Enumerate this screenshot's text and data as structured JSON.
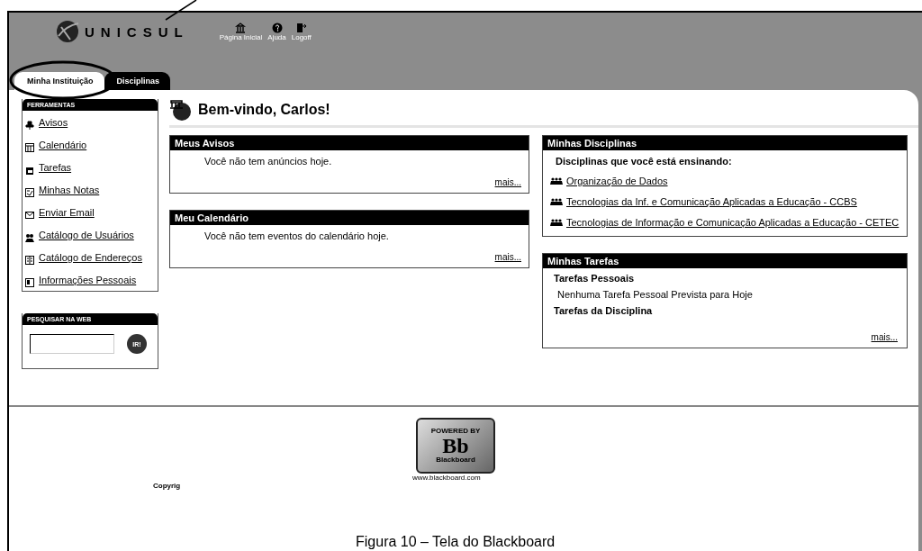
{
  "header": {
    "logo_text": "UNICSUL",
    "nav": [
      {
        "label": "Página Inicial",
        "kind": "home"
      },
      {
        "label": "Ajuda",
        "kind": "help"
      },
      {
        "label": "Logoff",
        "kind": "logoff"
      }
    ]
  },
  "tabs": [
    {
      "label": "Minha Instituição",
      "selected": true
    },
    {
      "label": "Disciplinas",
      "selected": false
    }
  ],
  "sidebar": {
    "title": "FERRAMENTAS",
    "items": [
      {
        "label": "Avisos",
        "kind": "pin"
      },
      {
        "label": "Calendário",
        "kind": "calendar"
      },
      {
        "label": "Tarefas",
        "kind": "tasks"
      },
      {
        "label": "Minhas Notas",
        "kind": "notes"
      },
      {
        "label": "Enviar Email",
        "kind": "mail"
      },
      {
        "label": "Catálogo de Usuários",
        "kind": "users"
      },
      {
        "label": "Catálogo de Endereços",
        "kind": "book"
      },
      {
        "label": "Informações Pessoais",
        "kind": "info"
      }
    ]
  },
  "web_search": {
    "title": "PESQUISAR NA WEB",
    "button": "IR!"
  },
  "welcome": "Bem-vindo, Carlos!",
  "left_modules": [
    {
      "title": "Meus Avisos",
      "text": "Você não tem anúncios hoje.",
      "more": "mais..."
    },
    {
      "title": "Meu Calendário",
      "text": "Você não tem eventos do calendário hoje.",
      "more": "mais..."
    }
  ],
  "courses_module": {
    "title": "Minhas Disciplinas",
    "subtitle": "Disciplinas que você está ensinando:",
    "courses": [
      "Organização de Dados",
      "Tecnologias da Inf. e Comunicação Aplicadas a Educação - CCBS",
      "Tecnologias de Informação e Comunicação Aplicadas a Educação - CETEC"
    ]
  },
  "tasks_module": {
    "title": "Minhas Tarefas",
    "personal_heading": "Tarefas Pessoais",
    "personal_text": "Nenhuma Tarefa Pessoal Prevista para Hoje",
    "course_heading": "Tarefas da Disciplina",
    "more": "mais..."
  },
  "footer": {
    "badge_top": "POWERED BY",
    "badge_mark": "Bb",
    "badge_bottom": "Blackboard",
    "url": "www.blackboard.com",
    "copyright": "Copyrig"
  },
  "caption": "Figura 10 – Tela do Blackboard"
}
